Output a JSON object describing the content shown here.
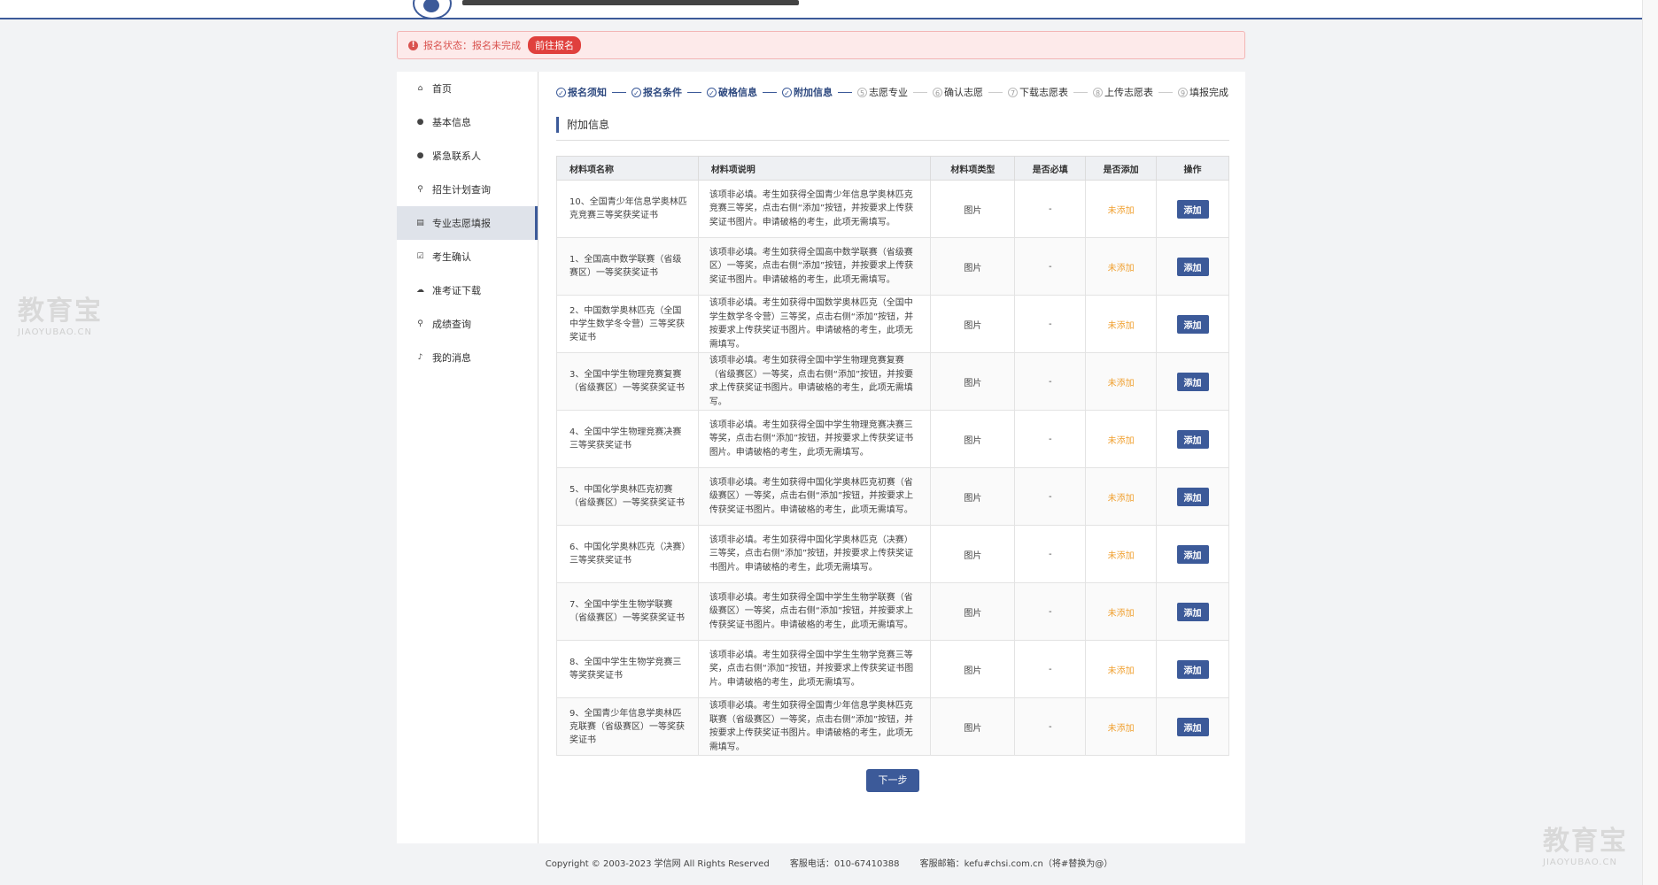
{
  "alert": {
    "label": "报名状态：报名未完成",
    "button": "前往报名"
  },
  "sidebar": {
    "items": [
      {
        "icon": "home-icon",
        "glyph": "⌂",
        "label": "首页"
      },
      {
        "icon": "user-icon",
        "glyph": "●",
        "label": "基本信息"
      },
      {
        "icon": "contact-icon",
        "glyph": "●",
        "label": "紧急联系人"
      },
      {
        "icon": "search-icon",
        "glyph": "⚲",
        "label": "招生计划查询"
      },
      {
        "icon": "form-icon",
        "glyph": "▤",
        "label": "专业志愿填报"
      },
      {
        "icon": "check-icon",
        "glyph": "☑",
        "label": "考生确认"
      },
      {
        "icon": "cloud-download-icon",
        "glyph": "☁",
        "label": "准考证下载"
      },
      {
        "icon": "search-icon",
        "glyph": "⚲",
        "label": "成绩查询"
      },
      {
        "icon": "bell-icon",
        "glyph": "♪",
        "label": "我的消息"
      }
    ]
  },
  "steps": [
    {
      "num": "✓",
      "label": "报名须知",
      "done": true
    },
    {
      "num": "✓",
      "label": "报名条件",
      "done": true
    },
    {
      "num": "✓",
      "label": "破格信息",
      "done": true
    },
    {
      "num": "✓",
      "label": "附加信息",
      "done": true
    },
    {
      "num": "5",
      "label": "志愿专业",
      "done": false
    },
    {
      "num": "6",
      "label": "确认志愿",
      "done": false
    },
    {
      "num": "7",
      "label": "下载志愿表",
      "done": false
    },
    {
      "num": "8",
      "label": "上传志愿表",
      "done": false
    },
    {
      "num": "9",
      "label": "填报完成",
      "done": false
    }
  ],
  "section": {
    "title": "附加信息"
  },
  "table": {
    "headers": [
      "材料项名称",
      "材料项说明",
      "材料项类型",
      "是否必填",
      "是否添加",
      "操作"
    ],
    "rows": [
      {
        "name": "10、全国青少年信息学奥林匹克竞赛三等奖获奖证书",
        "desc": "该项非必填。考生如获得全国青少年信息学奥林匹克竞赛三等奖，点击右侧“添加”按钮，并按要求上传获奖证书图片。申请破格的考生，此项无需填写。",
        "type": "图片",
        "required": "-",
        "status": "未添加",
        "action": "添加"
      },
      {
        "name": "1、全国高中数学联赛（省级赛区）一等奖获奖证书",
        "desc": "该项非必填。考生如获得全国高中数学联赛（省级赛区）一等奖，点击右侧“添加”按钮，并按要求上传获奖证书图片。申请破格的考生，此项无需填写。",
        "type": "图片",
        "required": "-",
        "status": "未添加",
        "action": "添加"
      },
      {
        "name": "2、中国数学奥林匹克（全国中学生数学冬令营）三等奖获奖证书",
        "desc": "该项非必填。考生如获得中国数学奥林匹克（全国中学生数学冬令营）三等奖，点击右侧“添加”按钮，并按要求上传获奖证书图片。申请破格的考生，此项无需填写。",
        "type": "图片",
        "required": "-",
        "status": "未添加",
        "action": "添加"
      },
      {
        "name": "3、全国中学生物理竞赛复赛（省级赛区）一等奖获奖证书",
        "desc": "该项非必填。考生如获得全国中学生物理竞赛复赛（省级赛区）一等奖，点击右侧“添加”按钮，并按要求上传获奖证书图片。申请破格的考生，此项无需填写。",
        "type": "图片",
        "required": "-",
        "status": "未添加",
        "action": "添加"
      },
      {
        "name": "4、全国中学生物理竞赛决赛三等奖获奖证书",
        "desc": "该项非必填。考生如获得全国中学生物理竞赛决赛三等奖，点击右侧“添加”按钮，并按要求上传获奖证书图片。申请破格的考生，此项无需填写。",
        "type": "图片",
        "required": "-",
        "status": "未添加",
        "action": "添加"
      },
      {
        "name": "5、中国化学奥林匹克初赛（省级赛区）一等奖获奖证书",
        "desc": "该项非必填。考生如获得中国化学奥林匹克初赛（省级赛区）一等奖，点击右侧“添加”按钮，并按要求上传获奖证书图片。申请破格的考生，此项无需填写。",
        "type": "图片",
        "required": "-",
        "status": "未添加",
        "action": "添加"
      },
      {
        "name": "6、中国化学奥林匹克（决赛）三等奖获奖证书",
        "desc": "该项非必填。考生如获得中国化学奥林匹克（决赛）三等奖，点击右侧“添加”按钮，并按要求上传获奖证书图片。申请破格的考生，此项无需填写。",
        "type": "图片",
        "required": "-",
        "status": "未添加",
        "action": "添加"
      },
      {
        "name": "7、全国中学生生物学联赛（省级赛区）一等奖获奖证书",
        "desc": "该项非必填。考生如获得全国中学生生物学联赛（省级赛区）一等奖，点击右侧“添加”按钮，并按要求上传获奖证书图片。申请破格的考生，此项无需填写。",
        "type": "图片",
        "required": "-",
        "status": "未添加",
        "action": "添加"
      },
      {
        "name": "8、全国中学生生物学竞赛三等奖获奖证书",
        "desc": "该项非必填。考生如获得全国中学生生物学竞赛三等奖，点击右侧“添加”按钮，并按要求上传获奖证书图片。申请破格的考生，此项无需填写。",
        "type": "图片",
        "required": "-",
        "status": "未添加",
        "action": "添加"
      },
      {
        "name": "9、全国青少年信息学奥林匹克联赛（省级赛区）一等奖获奖证书",
        "desc": "该项非必填。考生如获得全国青少年信息学奥林匹克联赛（省级赛区）一等奖，点击右侧“添加”按钮，并按要求上传获奖证书图片。申请破格的考生，此项无需填写。",
        "type": "图片",
        "required": "-",
        "status": "未添加",
        "action": "添加"
      }
    ]
  },
  "next_button": "下一步",
  "footer": {
    "copyright": "Copyright © 2003-2023 学信网 All Rights Reserved",
    "phone": "客服电话：010-67410388",
    "email": "客服邮箱：kefu#chsi.com.cn（将#替换为@）"
  },
  "watermark": {
    "text": "教育宝",
    "sub": "JIAOYUBAO.CN"
  }
}
